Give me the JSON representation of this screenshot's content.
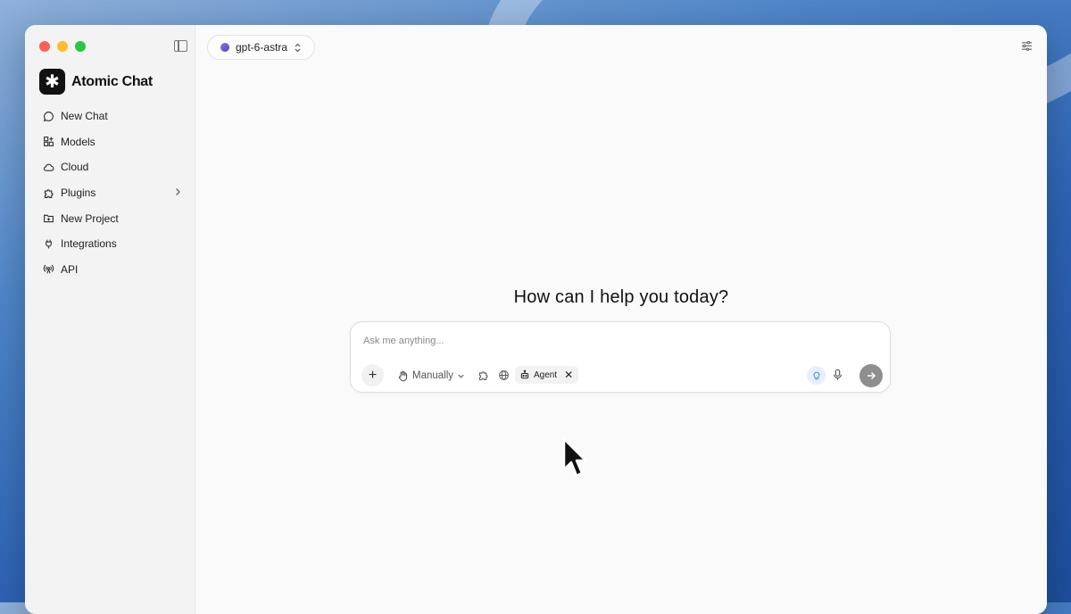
{
  "app": {
    "name": "Atomic Chat",
    "logo_icon": "asterisk-logo-icon"
  },
  "window": {
    "controls": [
      "close",
      "minimize",
      "zoom"
    ]
  },
  "sidebar": {
    "toggle_icon": "sidebar-toggle-icon",
    "items": [
      {
        "label": "New Chat",
        "icon": "chat-bubble-icon"
      },
      {
        "label": "Models",
        "icon": "grid-plus-icon"
      },
      {
        "label": "Cloud",
        "icon": "cloud-icon"
      },
      {
        "label": "Plugins",
        "icon": "puzzle-icon",
        "has_submenu": true
      },
      {
        "label": "New Project",
        "icon": "folder-plus-icon"
      },
      {
        "label": "Integrations",
        "icon": "plug-icon"
      },
      {
        "label": "API",
        "icon": "broadcast-icon"
      }
    ]
  },
  "header": {
    "model_selector": "gpt-6-astra",
    "settings_icon": "sliders-icon"
  },
  "main": {
    "greeting": "How can I help you today?",
    "composer": {
      "placeholder": "Ask me anything...",
      "mode": "Manually",
      "agent_chip": "Agent",
      "agent_close": "✕",
      "plus": "+",
      "colors": {
        "send": "#8e8e8e",
        "idea": "#e6f0fb",
        "idea_icon": "#4a90d9"
      }
    }
  }
}
